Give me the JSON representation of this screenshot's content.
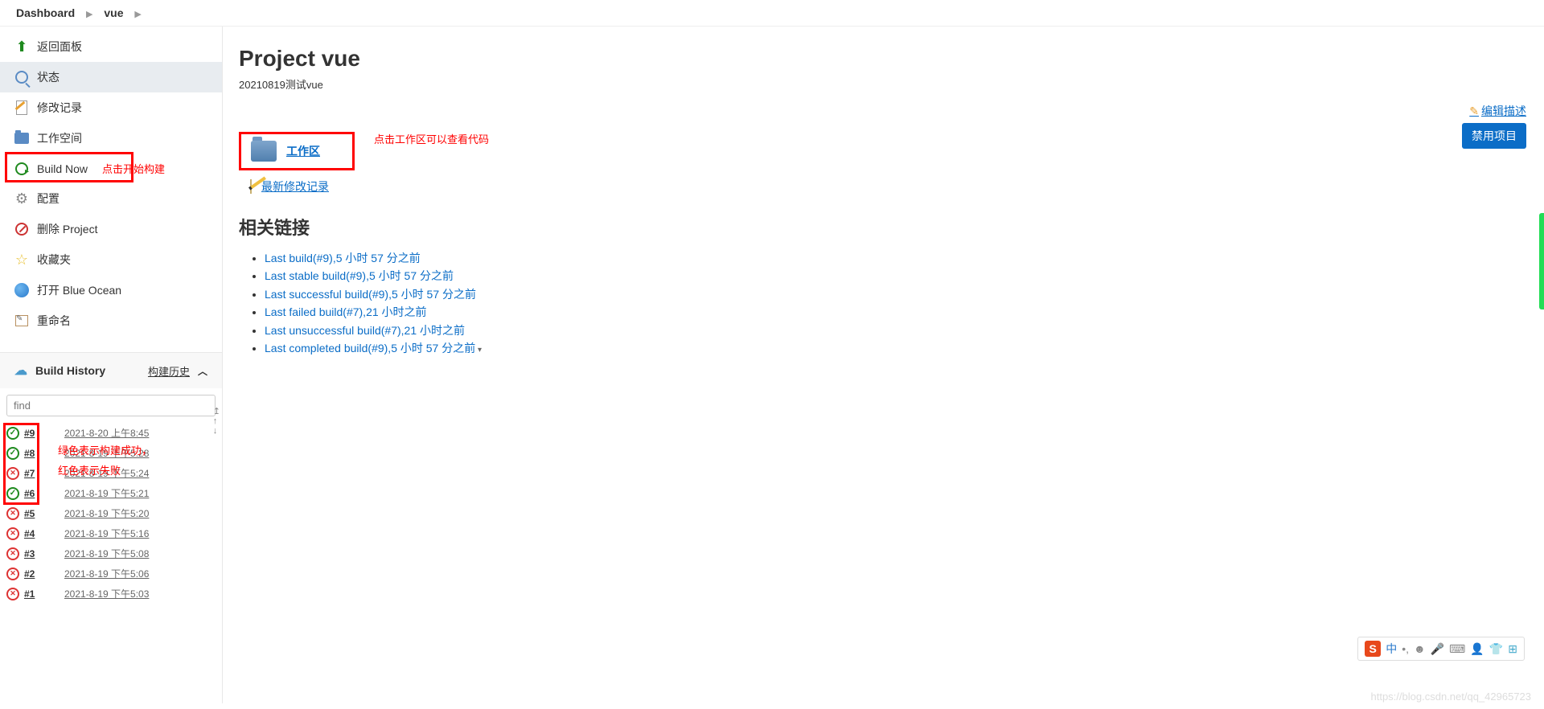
{
  "breadcrumb": {
    "dashboard": "Dashboard",
    "project": "vue"
  },
  "sidebar": {
    "items": [
      {
        "label": "返回面板"
      },
      {
        "label": "状态"
      },
      {
        "label": "修改记录"
      },
      {
        "label": "工作空间"
      },
      {
        "label": "Build Now"
      },
      {
        "label": "配置"
      },
      {
        "label": "删除 Project"
      },
      {
        "label": "收藏夹"
      },
      {
        "label": "打开 Blue Ocean"
      },
      {
        "label": "重命名"
      }
    ],
    "build_now_anno": "点击开始构建"
  },
  "build_history": {
    "title": "Build History",
    "trend": "构建历史",
    "find_placeholder": "find",
    "anno_line1": "绿色表示构建成功，",
    "anno_line2": "红色表示失败",
    "rows": [
      {
        "status": "ok",
        "num": "#9",
        "time": "2021-8-20 上午8:45"
      },
      {
        "status": "ok",
        "num": "#8",
        "time": "2021-8-19 下午5:28"
      },
      {
        "status": "fail",
        "num": "#7",
        "time": "2021-8-19 下午5:24"
      },
      {
        "status": "ok",
        "num": "#6",
        "time": "2021-8-19 下午5:21"
      },
      {
        "status": "fail",
        "num": "#5",
        "time": "2021-8-19 下午5:20"
      },
      {
        "status": "fail",
        "num": "#4",
        "time": "2021-8-19 下午5:16"
      },
      {
        "status": "fail",
        "num": "#3",
        "time": "2021-8-19 下午5:08"
      },
      {
        "status": "fail",
        "num": "#2",
        "time": "2021-8-19 下午5:06"
      },
      {
        "status": "fail",
        "num": "#1",
        "time": "2021-8-19 下午5:03"
      }
    ]
  },
  "main": {
    "title": "Project vue",
    "description": "20210819测试vue",
    "edit_desc": "编辑描述",
    "disable_btn": "禁用项目",
    "workspace_link": "工作区",
    "workspace_anno": "点击工作区可以查看代码",
    "changes_link": "最新修改记录",
    "related_heading": "相关链接",
    "links": [
      "Last build(#9),5 小时 57 分之前",
      "Last stable build(#9),5 小时 57 分之前",
      "Last successful build(#9),5 小时 57 分之前",
      "Last failed build(#7),21 小时之前",
      "Last unsuccessful build(#7),21 小时之前",
      "Last completed build(#9),5 小时 57 分之前"
    ]
  },
  "ime": {
    "lang": "中"
  },
  "watermark": "https://blog.csdn.net/qq_42965723"
}
